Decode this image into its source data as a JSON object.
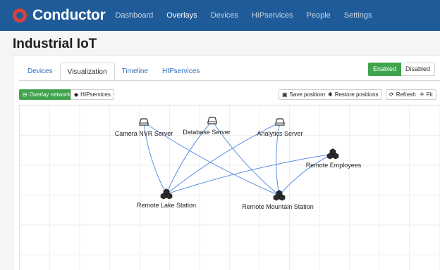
{
  "app": {
    "name": "Conductor"
  },
  "nav": {
    "items": [
      "Dashboard",
      "Overlays",
      "Devices",
      "HIPservices",
      "People",
      "Settings"
    ],
    "active_index": 1
  },
  "page": {
    "title": "Industrial IoT"
  },
  "tabs": {
    "items": [
      "Devices",
      "Visualization",
      "Timeline",
      "HIPservices"
    ],
    "active_index": 1
  },
  "status_toggle": {
    "enabled_label": "Enabled",
    "disabled_label": "Disabled",
    "selected": "Enabled"
  },
  "toolbar": {
    "overlay_network_label": "Overlay network",
    "hipservices_label": "HIPservices",
    "save_positions_label": "Save positions",
    "restore_positions_label": "Restore positions",
    "refresh_label": "Refresh",
    "fit_label": "Fit"
  },
  "graph": {
    "nodes": [
      {
        "id": "camera",
        "label": "Camera NVR Server",
        "icon": "server-icon"
      },
      {
        "id": "database",
        "label": "Database Server",
        "icon": "server-icon"
      },
      {
        "id": "analytics",
        "label": "Analytics Server",
        "icon": "server-icon"
      },
      {
        "id": "employees",
        "label": "Remote Employees",
        "icon": "cluster-icon"
      },
      {
        "id": "lake",
        "label": "Remote Lake Station",
        "icon": "cluster-icon"
      },
      {
        "id": "mountain",
        "label": "Remote Mountain Station",
        "icon": "cluster-icon"
      }
    ],
    "edges": [
      [
        "camera",
        "lake"
      ],
      [
        "camera",
        "mountain"
      ],
      [
        "database",
        "lake"
      ],
      [
        "database",
        "mountain"
      ],
      [
        "analytics",
        "lake"
      ],
      [
        "analytics",
        "mountain"
      ],
      [
        "employees",
        "lake"
      ],
      [
        "employees",
        "mountain"
      ]
    ],
    "edge_color": "#5b8fe0"
  },
  "colors": {
    "navbar": "#1f5b99",
    "accent_green": "#3fa44d",
    "link": "#2a6ebb",
    "logo": "#d9413a"
  }
}
